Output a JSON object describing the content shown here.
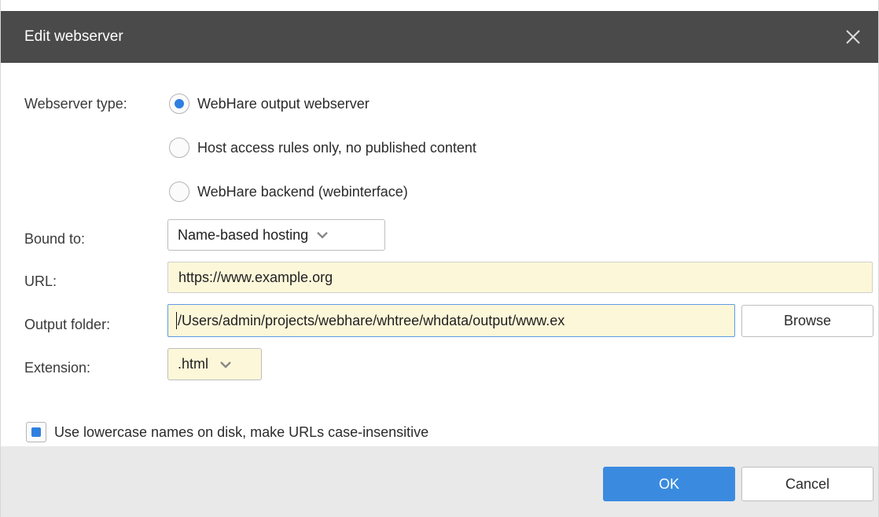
{
  "dialog": {
    "title": "Edit webserver"
  },
  "form": {
    "webserver_type_label": "Webserver type:",
    "webserver_type_options": [
      {
        "label": "WebHare output webserver",
        "checked": true
      },
      {
        "label": "Host access rules only, no published content",
        "checked": false
      },
      {
        "label": "WebHare backend (webinterface)",
        "checked": false
      }
    ],
    "bound_to_label": "Bound to:",
    "bound_to_value": "Name-based hosting",
    "url_label": "URL:",
    "url_value": "https://www.example.org",
    "output_folder_label": "Output folder:",
    "output_folder_value": "/Users/admin/projects/webhare/whtree/whdata/output/www.ex",
    "browse_label": "Browse",
    "extension_label": "Extension:",
    "extension_value": ".html",
    "lowercase_label": "Use lowercase names on disk, make URLs case-insensitive",
    "lowercase_checked": true
  },
  "footer": {
    "ok_label": "OK",
    "cancel_label": "Cancel"
  },
  "icons": {
    "close": "close-icon",
    "dropdown": "chevron-down-icon"
  },
  "colors": {
    "titlebar": "#4a4a4a",
    "accent": "#2f7fe0",
    "required_field": "#fdf7d9",
    "footer": "#e9e9e9"
  }
}
